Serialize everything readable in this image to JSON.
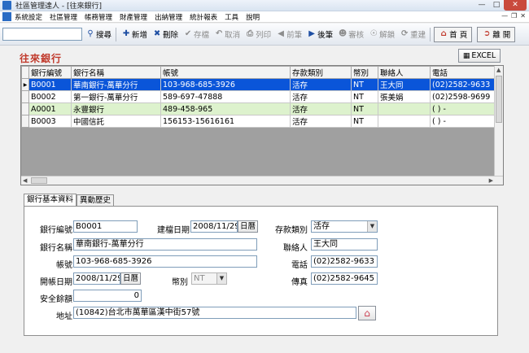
{
  "window": {
    "title": "社區管理達人 - [往來銀行]"
  },
  "menu": {
    "items": [
      "系統設定",
      "社區管理",
      "帳務管理",
      "財產管理",
      "出納管理",
      "統計報表",
      "工具",
      "說明"
    ]
  },
  "toolbar": {
    "search_value": "",
    "search": "搜尋",
    "add": "新增",
    "delete": "刪除",
    "save": "存檔",
    "cancel": "取消",
    "print": "列印",
    "prev": "前筆",
    "next": "後筆",
    "review": "審核",
    "unlock": "解鎖",
    "recheck": "重建",
    "home": "首 頁",
    "exit": "離 開"
  },
  "section": {
    "title": "往來銀行",
    "excel": "EXCEL"
  },
  "grid": {
    "headers": [
      "銀行編號",
      "銀行名稱",
      "帳號",
      "存款類別",
      "幣別",
      "聯絡人",
      "電話"
    ],
    "rows": [
      [
        "B0001",
        "華南銀行-萬華分行",
        "103-968-685-3926",
        "活存",
        "NT",
        "王大同",
        "(02)2582-9633"
      ],
      [
        "B0002",
        "第一銀行-萬華分行",
        "589-697-47888",
        "活存",
        "NT",
        "張美娟",
        "(02)2598-9699"
      ],
      [
        "A0001",
        "永豐銀行",
        "489-458-965",
        "活存",
        "NT",
        "",
        "( )  -"
      ],
      [
        "B0003",
        "中國信託",
        "156153-15616161",
        "活存",
        "NT",
        "",
        "( )  -"
      ]
    ]
  },
  "tabs": {
    "basic": "銀行基本資料",
    "history": "異動歷史"
  },
  "form": {
    "bank_id_label": "銀行編號",
    "bank_id": "B0001",
    "created_label": "建檔日期",
    "created": "2008/11/29",
    "calendar": "日曆",
    "deposit_type_label": "存款類別",
    "deposit_type": "活存",
    "bank_name_label": "銀行名稱",
    "bank_name": "華南銀行-萬華分行",
    "contact_label": "聯絡人",
    "contact": "王大同",
    "account_label": "帳號",
    "account": "103-968-685-3926",
    "phone_label": "電話",
    "phone": "(02)2582-9633",
    "open_date_label": "開帳日期",
    "open_date": "2008/11/29",
    "currency_label": "幣別",
    "currency": "NT",
    "fax_label": "傳真",
    "fax": "(02)2582-9645",
    "safety_label": "安全餘額",
    "safety": "0",
    "address_label": "地址",
    "address": "(10842)台北市萬華區漢中街57號"
  }
}
